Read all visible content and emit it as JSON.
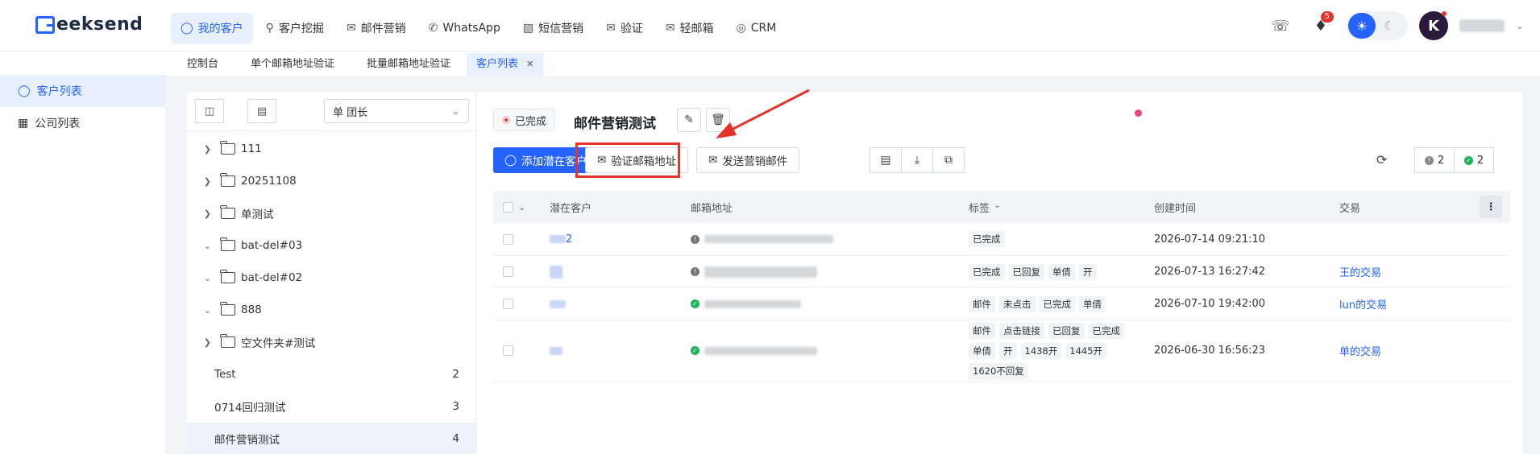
{
  "header": {
    "logo": "eeksend",
    "nav": [
      {
        "label": "我的客户",
        "icon": "user-icon",
        "active": true
      },
      {
        "label": "客户挖掘",
        "icon": "search-icon"
      },
      {
        "label": "邮件营销",
        "icon": "mail-icon"
      },
      {
        "label": "WhatsApp",
        "icon": "whatsapp-icon"
      },
      {
        "label": "短信营销",
        "icon": "sms-icon"
      },
      {
        "label": "验证",
        "icon": "verify-icon"
      },
      {
        "label": "轻邮箱",
        "icon": "light-mail-icon"
      },
      {
        "label": "CRM",
        "icon": "crm-icon"
      }
    ],
    "notification_count": "5",
    "avatar_letter": "K"
  },
  "tabs": [
    {
      "label": "控制台"
    },
    {
      "label": "单个邮箱地址验证"
    },
    {
      "label": "批量邮箱地址验证"
    },
    {
      "label": "客户列表",
      "active": true
    }
  ],
  "sidebar": {
    "items": [
      {
        "label": "客户列表",
        "active": true
      },
      {
        "label": "公司列表"
      }
    ]
  },
  "folder_panel": {
    "select_value": "单 团长",
    "folders": [
      {
        "label": "111",
        "expanded": false
      },
      {
        "label": "20251108",
        "expanded": false
      },
      {
        "label": "单测试",
        "expanded": false
      },
      {
        "label": "bat-del#03",
        "expanded": true
      },
      {
        "label": "bat-del#02",
        "expanded": true
      },
      {
        "label": "888",
        "expanded": true
      },
      {
        "label": "空文件夹#测试",
        "expanded": false
      }
    ],
    "lists": [
      {
        "label": "Test",
        "count": "2"
      },
      {
        "label": "0714回归测试",
        "count": "3"
      },
      {
        "label": "邮件营销测试",
        "count": "4",
        "active": true
      }
    ]
  },
  "main": {
    "status": "已完成",
    "title": "邮件营销测试",
    "buttons": {
      "add": "添加潜在客户",
      "verify": "验证邮箱地址",
      "send": "发送营销邮件"
    },
    "counters": {
      "gray": "2",
      "green": "2"
    },
    "columns": {
      "name": "潜在客户",
      "email": "邮箱地址",
      "tags": "标签",
      "time": "创建时间",
      "deal": "交易"
    },
    "rows": [
      {
        "name": "2",
        "email_status": "gray",
        "tags": [
          "已完成"
        ],
        "time": "2026-07-14 09:21:10",
        "deal": ""
      },
      {
        "name": "",
        "email_status": "gray",
        "tags": [
          "已完成",
          "已回复",
          "单倩",
          "开"
        ],
        "time": "2026-07-13 16:27:42",
        "deal": "王的交易"
      },
      {
        "name": "",
        "email_status": "green",
        "tags": [
          "邮件",
          "未点击",
          "已完成",
          "单倩"
        ],
        "time": "2026-07-10 19:42:00",
        "deal": "lun的交易"
      },
      {
        "name": "",
        "email_status": "green",
        "tags": [
          "邮件",
          "点击链接",
          "已回复",
          "已完成",
          "单倩",
          "开",
          "1438开",
          "1445开",
          "1620不回复"
        ],
        "time": "2026-06-30 16:56:23",
        "deal": "单的交易"
      }
    ]
  },
  "colors": {
    "accent": "#2463ff",
    "highlight": "#e4342c",
    "success": "#1fb35a"
  }
}
